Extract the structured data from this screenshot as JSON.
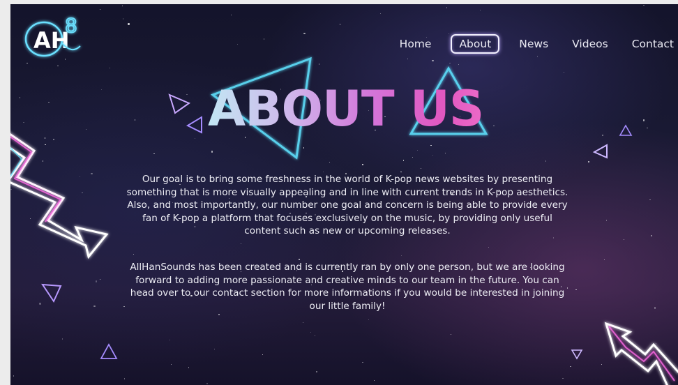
{
  "site": {
    "logo_text": "AH",
    "logo_sup": "8"
  },
  "nav": {
    "items": [
      {
        "label": "Home",
        "active": false
      },
      {
        "label": "About",
        "active": true
      },
      {
        "label": "News",
        "active": false
      },
      {
        "label": "Videos",
        "active": false
      },
      {
        "label": "Contact",
        "active": false
      }
    ]
  },
  "hero": {
    "title": "ABOUT US"
  },
  "content": {
    "paragraph_1": "Our goal is to bring some freshness in the world of K-pop news websites by presenting something that is more visually appealing and in line with current trends in K-pop aesthetics. Also, and most importantly, our number one goal and concern is being able to provide every fan of K-pop a platform that focuses exclusively on the music, by providing only useful content such as new or upcoming releases.",
    "paragraph_2": "AllHanSounds has been created and is currently ran by only one person, but we are looking forward to adding more passionate and creative minds to our team in the future. You can head over to our contact section for more informations if you would be interested in joining our little family!"
  },
  "colors": {
    "background": "#16142c",
    "neon_cyan": "#5fe3ff",
    "neon_pink": "#ff6be6",
    "neon_purple": "#a58cff",
    "text": "#ededf4"
  },
  "decorations": [
    "triangle-outline-icon",
    "zigzag-arrow-icon"
  ]
}
